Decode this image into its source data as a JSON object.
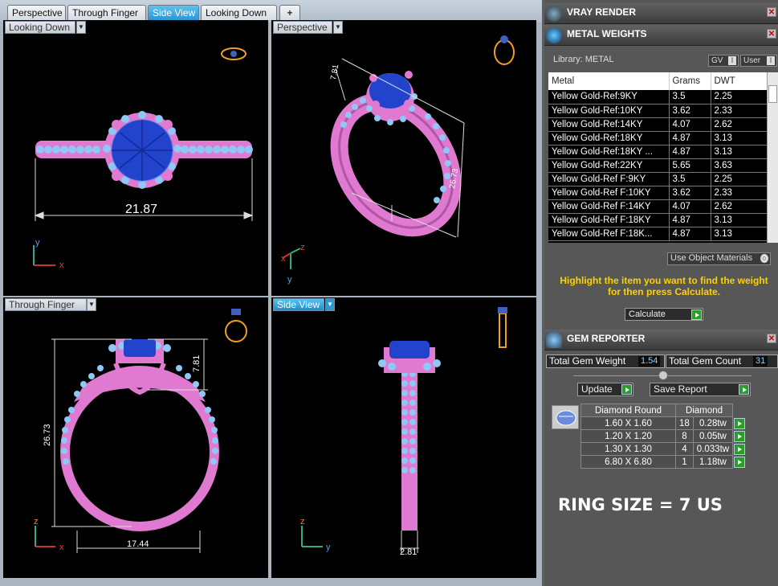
{
  "tabs": [
    "Perspective",
    "Through Finger",
    "Side View",
    "Looking Down",
    "+"
  ],
  "active_tab": "Side View",
  "viewports": {
    "top_left": {
      "label": "Looking Down",
      "dimensions": [
        "21.87"
      ],
      "axes": [
        "y",
        "x"
      ]
    },
    "top_right": {
      "label": "Perspective",
      "dimensions": [
        "7.81",
        "26.73"
      ],
      "axes": [
        "z",
        "x",
        "y"
      ]
    },
    "bottom_left": {
      "label": "Through Finger",
      "dimensions": [
        "26.73",
        "7.81",
        "17.44"
      ],
      "axes": [
        "z",
        "x"
      ]
    },
    "bottom_right": {
      "label": "Side View",
      "dimensions": [
        "2.81"
      ],
      "axes": [
        "z",
        "y"
      ]
    }
  },
  "panels": {
    "vray": {
      "title": "VRAY RENDER"
    },
    "metal": {
      "title": "METAL WEIGHTS",
      "library_label": "Library: METAL",
      "gv_label": "GV",
      "user_label": "User",
      "columns": [
        "Metal",
        "Grams",
        "DWT"
      ],
      "rows": [
        [
          "Yellow Gold-Ref:9KY",
          "3.5",
          "2.25"
        ],
        [
          "Yellow Gold-Ref:10KY",
          "3.62",
          "2.33"
        ],
        [
          "Yellow Gold-Ref:14KY",
          "4.07",
          "2.62"
        ],
        [
          "Yellow Gold-Ref:18KY",
          "4.87",
          "3.13"
        ],
        [
          "Yellow Gold-Ref:18KY ...",
          "4.87",
          "3.13"
        ],
        [
          "Yellow Gold-Ref:22KY",
          "5.65",
          "3.63"
        ],
        [
          "Yellow Gold-Ref F:9KY",
          "3.5",
          "2.25"
        ],
        [
          "Yellow Gold-Ref F:10KY",
          "3.62",
          "2.33"
        ],
        [
          "Yellow Gold-Ref F:14KY",
          "4.07",
          "2.62"
        ],
        [
          "Yellow Gold-Ref F:18KY",
          "4.87",
          "3.13"
        ],
        [
          "Yellow Gold-Ref F:18K...",
          "4.87",
          "3.13"
        ]
      ],
      "use_object_materials": "Use Object Materials",
      "message": "Highlight the item you want to find the weight for then press Calculate.",
      "calculate_label": "Calculate"
    },
    "gem": {
      "title": "GEM REPORTER",
      "total_weight_label": "Total Gem Weight",
      "total_weight_value": "1.54",
      "total_count_label": "Total Gem Count",
      "total_count_value": "31",
      "update_label": "Update",
      "save_label": "Save Report",
      "header": [
        "Diamond Round",
        "Diamond"
      ],
      "rows": [
        [
          "1.60 X 1.60",
          "18",
          "0.28tw"
        ],
        [
          "1.20 X 1.20",
          "8",
          "0.05tw"
        ],
        [
          "1.30 X 1.30",
          "4",
          "0.033tw"
        ],
        [
          "6.80 X 6.80",
          "1",
          "1.18tw"
        ]
      ]
    }
  },
  "ring_size": "RING SIZE = 7 US",
  "colors": {
    "metal": "#e07ad0",
    "gem": "#2244cc",
    "melee": "#8fc7f5",
    "accent": "#2a98d6",
    "message": "#ffd000"
  }
}
